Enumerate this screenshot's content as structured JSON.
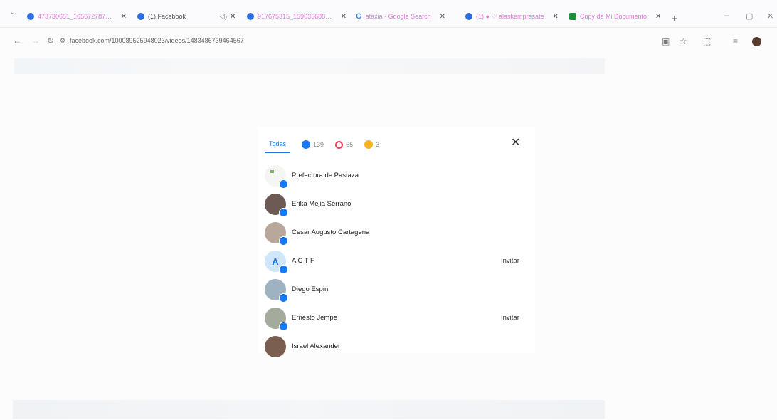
{
  "browser": {
    "tabs": [
      {
        "title": "473730651_1656727872...",
        "closable": true
      },
      {
        "title": "(1) Facebook",
        "closable": false,
        "audio": true
      },
      {
        "title": "917675315_1596356880...",
        "closable": true
      },
      {
        "title": "ataxia - Google Search",
        "closable": true
      },
      {
        "title": "(1) ● ♡ alaskempresate",
        "closable": true
      },
      {
        "title": "Copy de Mi Documento",
        "closable": true
      }
    ],
    "url": "facebook.com/100089525948023/videos/1483486739464567",
    "icons": {
      "menu": "chevron-down-icon",
      "back": "back-arrow-icon",
      "reload": "reload-icon",
      "site_info": "site-info-icon",
      "cast": "cast-icon",
      "bookmark": "star-icon",
      "extensions": "puzzle-icon",
      "reading": "reading-list-icon",
      "profile": "avatar"
    }
  },
  "dialog": {
    "tabs": [
      {
        "label": "Todas",
        "active": true
      },
      {
        "label": "139",
        "icon": "like-reaction-icon"
      },
      {
        "label": "55",
        "icon": "love-reaction-icon"
      },
      {
        "label": "3",
        "icon": "care-reaction-icon"
      }
    ],
    "close_label": "✕",
    "people": [
      {
        "name": "Prefectura de Pastaza",
        "avatar": "page",
        "action": ""
      },
      {
        "name": "Erika Mejia Serrano",
        "avatar": "photo",
        "action": ""
      },
      {
        "name": "Cesar Augusto Cartagena",
        "avatar": "photo",
        "action": ""
      },
      {
        "name": "A C T F",
        "avatar": "letter",
        "letter": "A",
        "action": "Invitar"
      },
      {
        "name": "Diego Espin",
        "avatar": "photo",
        "action": ""
      },
      {
        "name": "Ernesto Jempe",
        "avatar": "photo",
        "action": "Invitar"
      },
      {
        "name": "Israel Alexander",
        "avatar": "photo",
        "action": ""
      }
    ]
  },
  "colors": {
    "accent": "#1b74e4",
    "like": "#1877f2",
    "love": "#f33e58",
    "care": "#f7b125",
    "tab_text": "#e07ad9"
  }
}
